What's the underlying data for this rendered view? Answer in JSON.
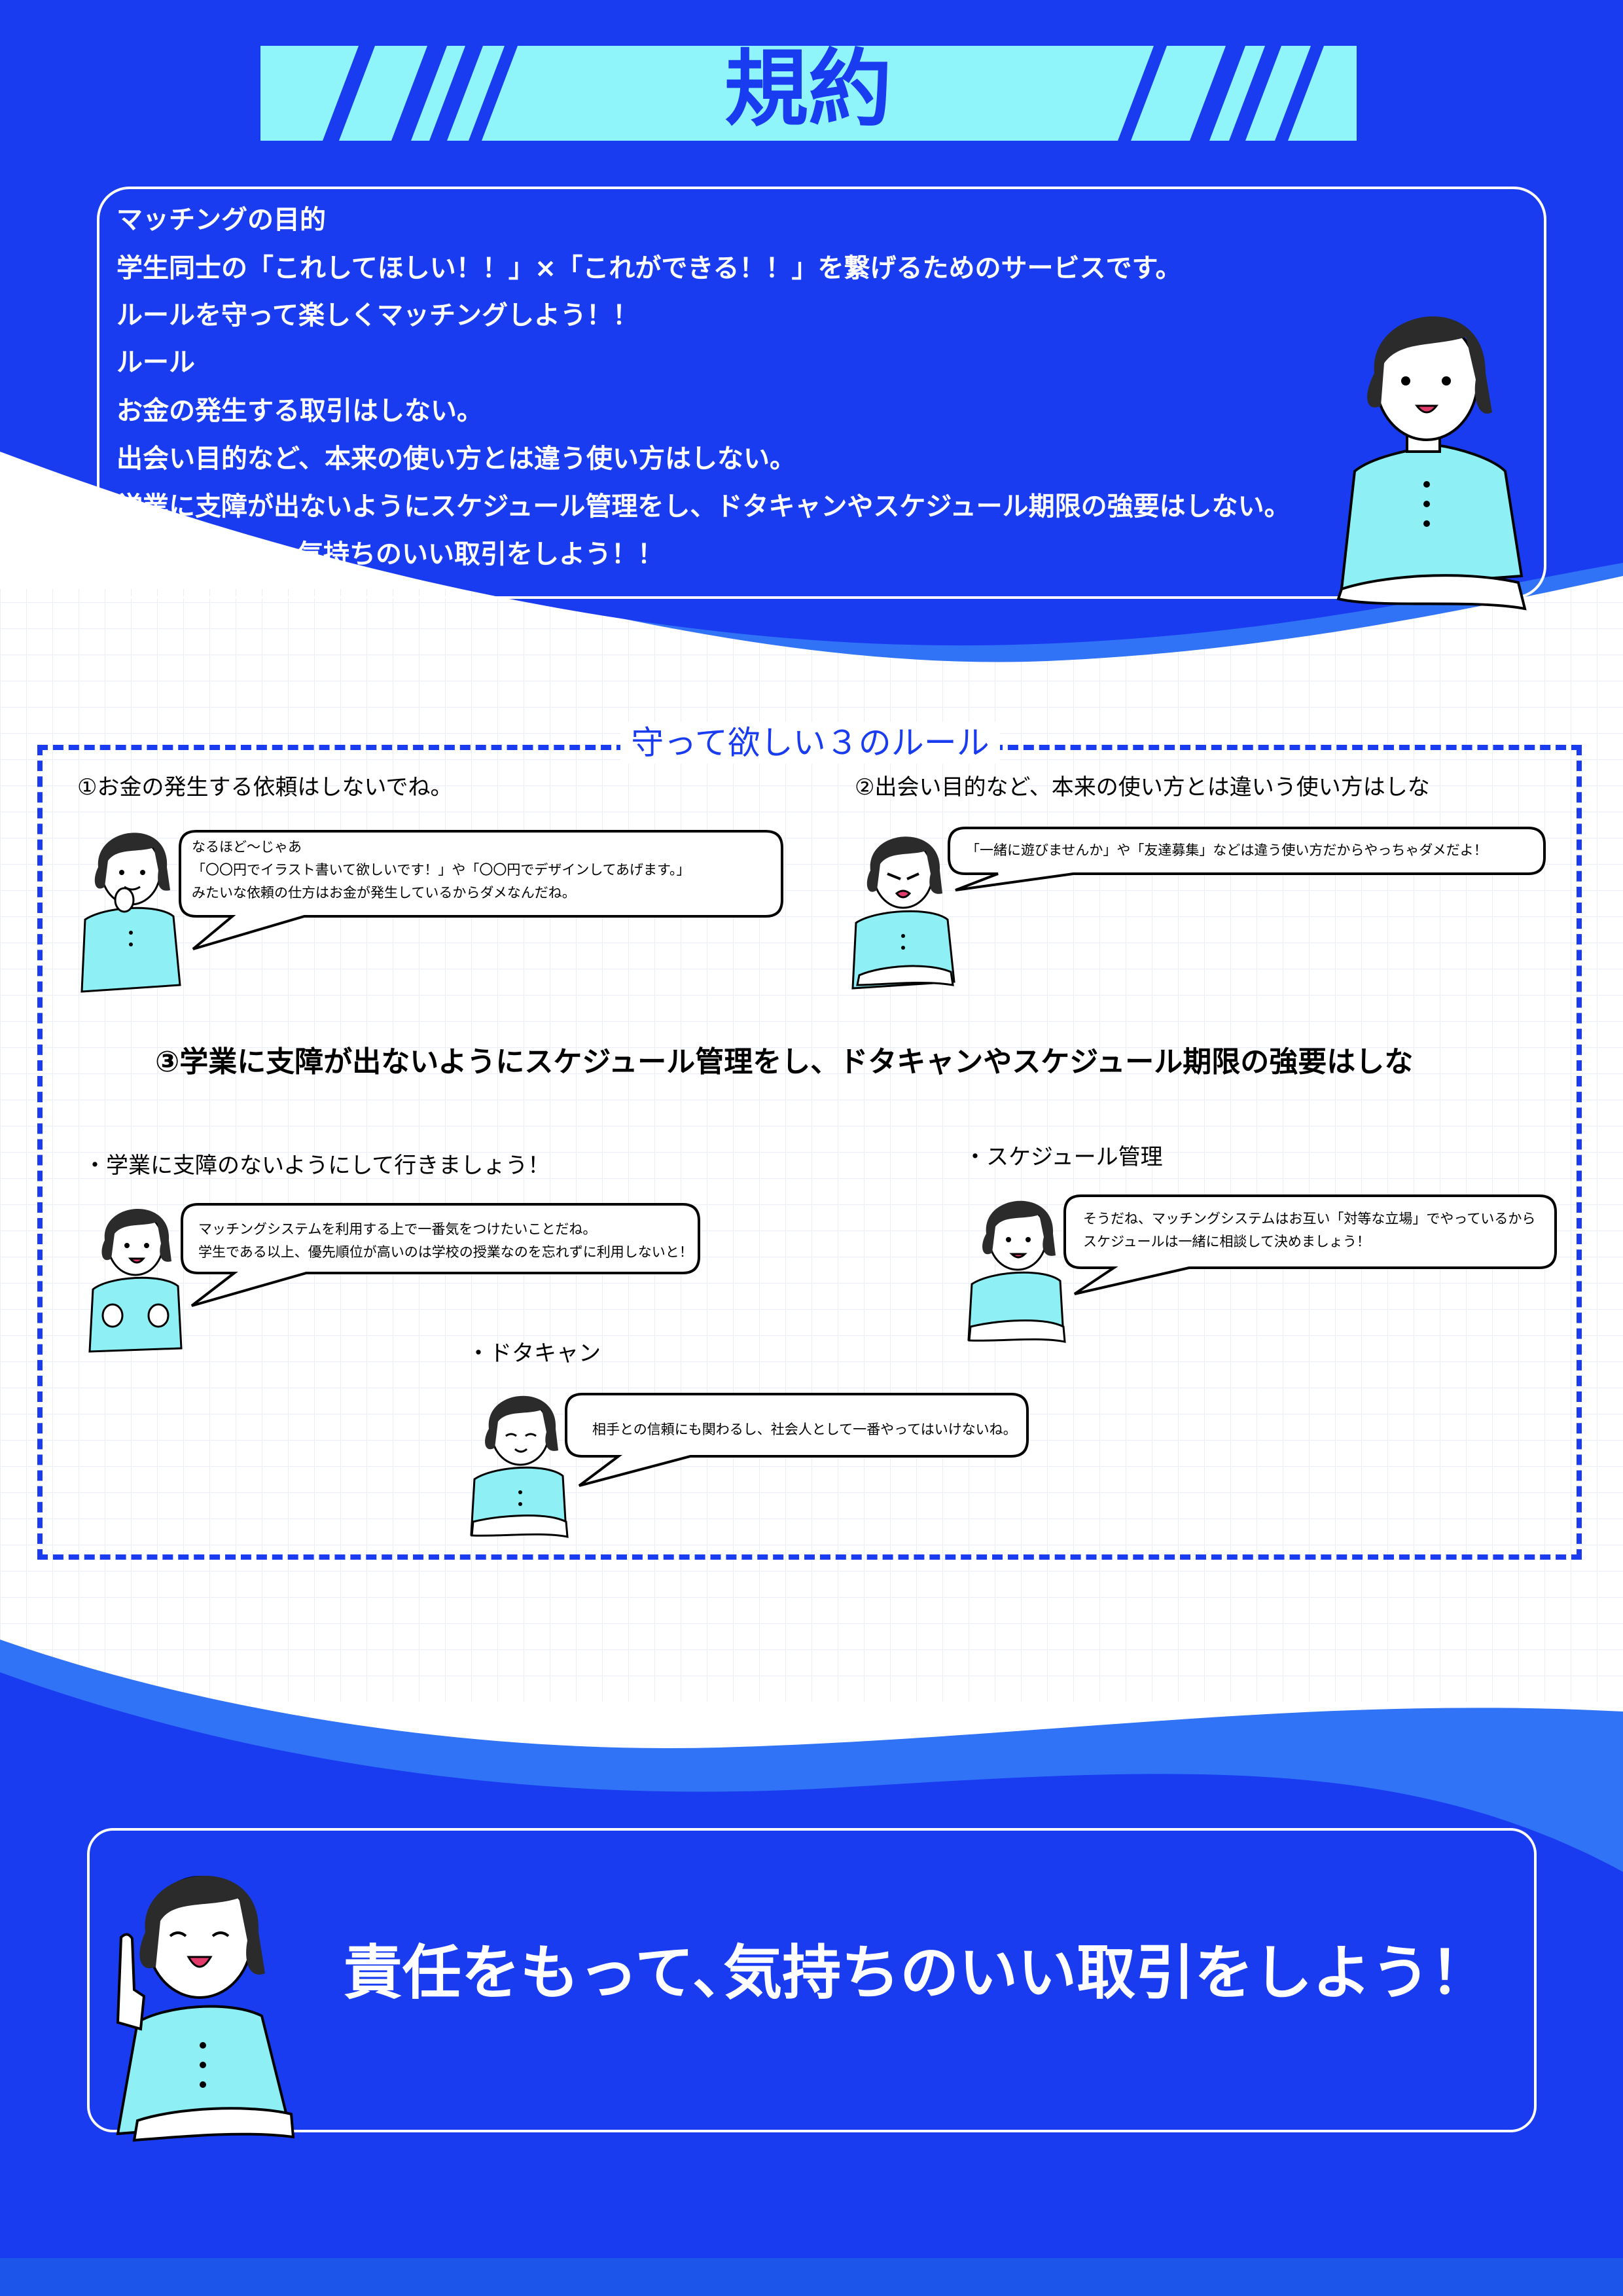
{
  "title": "規約",
  "intro": {
    "lines": [
      "マッチングの目的",
      "学生同士の「これしてほしい！！」×「これができる！！」を繋げるためのサービスです。",
      "ルールを守って楽しくマッチングしよう！！",
      "ルール",
      "お金の発生する取引はしない。",
      "出会い目的など、本来の使い方とは違う使い方はしない。",
      "学業に支障が出ないようにスケジュール管理をし、ドタキャンやスケジュール期限の強要はしない。",
      "責任を持って、気持ちのいい取引をしよう！！"
    ]
  },
  "rules": {
    "heading": "守って欲しい３のルール",
    "rule1": {
      "title": "①お金の発生する依頼はしないでね。",
      "bubble": [
        "なるほど〜じゃあ",
        "「〇〇円でイラスト書いて欲しいです！」や「〇〇円でデザインしてあげます。」",
        "みたいな依頼の仕方はお金が発生しているからダメなんだね。"
      ]
    },
    "rule2": {
      "title": "②出会い目的など、本来の使い方とは違いう使い方はしな",
      "bubble": [
        "「一緒に遊びませんか」や「友達募集」などは違う使い方だからやっちゃダメだよ！"
      ]
    },
    "rule3": {
      "title": "③学業に支障が出ないようにスケジュール管理をし、ドタキャンやスケジュール期限の強要はしな",
      "sub_study": {
        "title": "・学業に支障のないようにして行きましょう！",
        "bubble": [
          "マッチングシステムを利用する上で一番気をつけたいことだね。",
          "学生である以上、優先順位が高いのは学校の授業なのを忘れずに利用しないと！"
        ]
      },
      "sub_schedule": {
        "title": "・スケジュール管理",
        "bubble": [
          "そうだね、マッチングシステムはお互い「対等な立場」でやっているから",
          "スケジュールは一緒に相談して決めましょう！"
        ]
      },
      "sub_cancel": {
        "title": "・ドタキャン",
        "bubble": [
          "相手との信頼にも関わるし、社会人として一番やってはいけないね。"
        ]
      }
    }
  },
  "closing": "責任をもって､気持ちのいい取引をしよう！",
  "colors": {
    "royal_blue": "#1a3cf0",
    "light_blue": "#3173f7",
    "cyan": "#8ff5fb",
    "shirt": "#8ef0f4",
    "hair": "#2b2b2b",
    "white": "#ffffff"
  }
}
